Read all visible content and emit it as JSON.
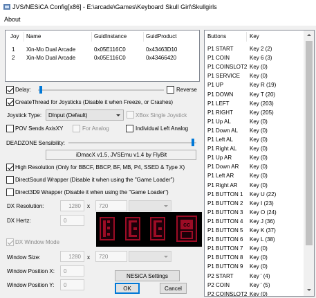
{
  "window": {
    "title": "JVS/NESiCA Config[x86] - E:\\arcade\\Games\\Keyboard Skull Girl\\Skullgirls"
  },
  "menu": {
    "about": "About"
  },
  "devices": {
    "headers": [
      "Joy",
      "Name",
      "GuidInstance",
      "GuidProduct"
    ],
    "rows": [
      {
        "joy": "1",
        "name": "Xin-Mo Dual Arcade",
        "guid_instance": "0x05E116C0",
        "guid_product": "0x43463D10"
      },
      {
        "joy": "2",
        "name": "Xin-Mo Dual Arcade",
        "guid_instance": "0x05E116C0",
        "guid_product": "0x43466420"
      }
    ]
  },
  "delay": {
    "label": "Delay:",
    "checked": true,
    "reverse_label": "Reverse",
    "reverse_checked": false,
    "slider_fraction": 0.0
  },
  "create_thread": {
    "label": "CreateThread for Joysticks (Disable it when Freeze, or Crashes)",
    "checked": true
  },
  "joystick_type": {
    "label": "Joystick Type:",
    "value": "DInput (Default)",
    "xbox_label": "XBox Single Joystick"
  },
  "pov": {
    "label": "POV Sends AxisXY",
    "for_analog_label": "For Analog",
    "individual_left_label": "Individual Left Analog"
  },
  "deadzone": {
    "label": "DEADZONE Sensibility:",
    "slider_fraction": 1.0
  },
  "version": "iDmacX v1.5, JVSEmu v1.4 by FlyBit",
  "options": {
    "high_res": {
      "label": "High Resolution (Only for BBCF, BBCP, BF, MB, P4, SSED & Type X)",
      "checked": true
    },
    "directsound": {
      "label": "DirectSound Wrapper (Disable it when using the \"Game Loader\")",
      "checked": false
    },
    "direct3d9": {
      "label": "Direct3D9 Wrapper (Disable it when using the \"Game Loader\")",
      "checked": false
    }
  },
  "dx": {
    "resolution_label": "DX Resolution:",
    "res_w": "1280",
    "res_x": "x",
    "res_h": "720",
    "hertz_label": "DX Hertz:",
    "hertz": "0",
    "window_mode_label": "DX Window Mode",
    "window_size_label": "Window Size:",
    "win_w": "1280",
    "win_x": "x",
    "win_h": "720",
    "pos_x_label": "Window Position X:",
    "pos_x": "0",
    "pos_y_label": "Window Position Y:",
    "pos_y": "0"
  },
  "buttons": {
    "nesica": "NESiCA Settings",
    "ok": "OK",
    "cancel": "Cancel"
  },
  "key_panel": {
    "headers": [
      "Buttons",
      "Key"
    ],
    "rows": [
      [
        "P1 START",
        "Key 2 (2)"
      ],
      [
        "P1 COIN",
        "Key 6 (3)"
      ],
      [
        "P1 COINSLOT2",
        "Key  (0)"
      ],
      [
        "P1 SERVICE",
        "Key  (0)"
      ],
      [
        "P1 UP",
        "Key R (19)"
      ],
      [
        "P1 DOWN",
        "Key T (20)"
      ],
      [
        "P1 LEFT",
        "Key  (203)"
      ],
      [
        "P1 RIGHT",
        "Key  (205)"
      ],
      [
        "P1 Up AL",
        "Key  (0)"
      ],
      [
        "P1 Down AL",
        "Key  (0)"
      ],
      [
        "P1 Left AL",
        "Key  (0)"
      ],
      [
        "P1 Right AL",
        "Key  (0)"
      ],
      [
        "P1 Up AR",
        "Key  (0)"
      ],
      [
        "P1 Down AR",
        "Key  (0)"
      ],
      [
        "P1 Left AR",
        "Key  (0)"
      ],
      [
        "P1 Right AR",
        "Key  (0)"
      ],
      [
        "P1 BUTTON 1",
        "Key U (22)"
      ],
      [
        "P1 BUTTON 2",
        "Key I (23)"
      ],
      [
        "P1 BUTTON 3",
        "Key O (24)"
      ],
      [
        "P1 BUTTON 4",
        "Key J (36)"
      ],
      [
        "P1 BUTTON 5",
        "Key K (37)"
      ],
      [
        "P1 BUTTON 6",
        "Key L (38)"
      ],
      [
        "P1 BUTTON 7",
        "Key  (0)"
      ],
      [
        "P1 BUTTON 8",
        "Key  (0)"
      ],
      [
        "P1 BUTTON 9",
        "Key  (0)"
      ],
      [
        "P2 START",
        "Key ' (4)"
      ],
      [
        "P2 COIN",
        "Key ' (5)"
      ],
      [
        "P2 COINSLOT2",
        "Key  (0)"
      ]
    ]
  },
  "colors": {
    "led": "#9c0c25",
    "accent": "#0078d7"
  }
}
